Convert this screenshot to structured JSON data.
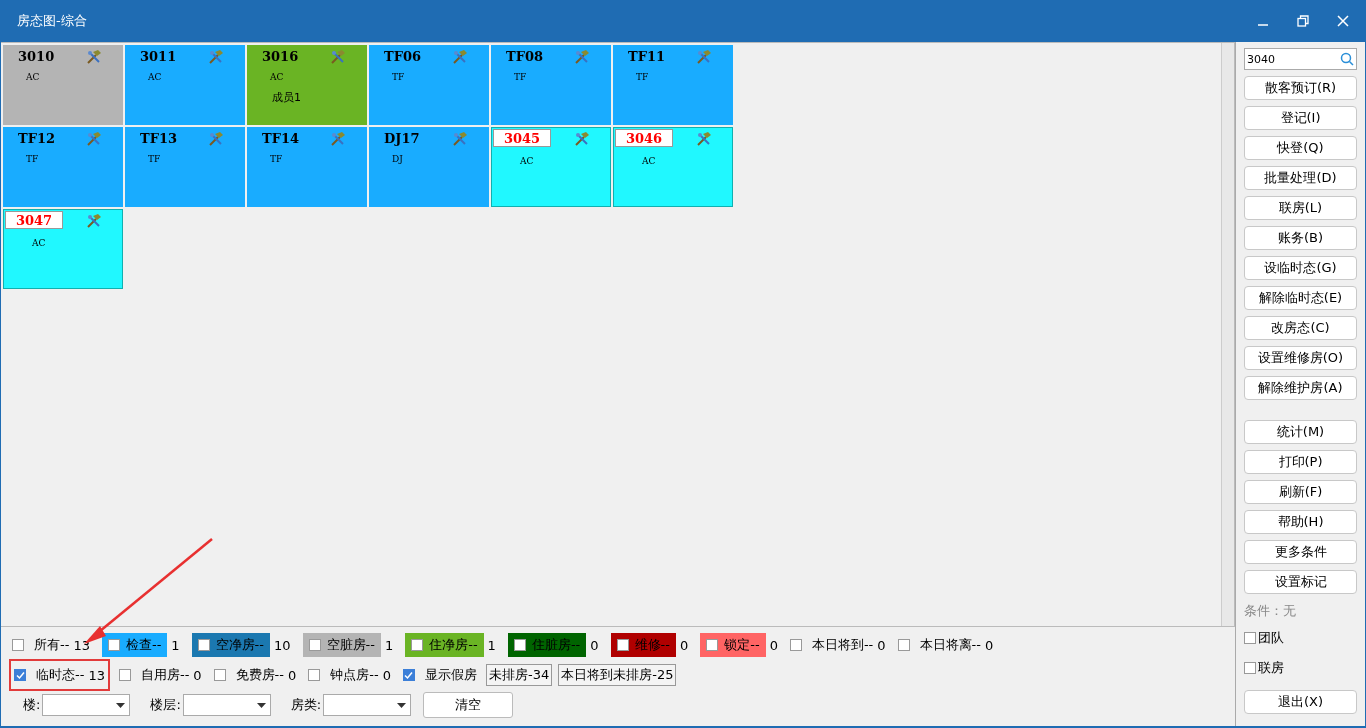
{
  "window": {
    "title": "房态图-综合"
  },
  "rooms": [
    {
      "number": "3010",
      "type": "AC",
      "color": "#b4b4b4",
      "temporary": false
    },
    {
      "number": "3011",
      "type": "AC",
      "color": "#19acff",
      "temporary": false
    },
    {
      "number": "3016",
      "type": "AC",
      "member": "成员1",
      "color": "#6ab424",
      "temporary": false
    },
    {
      "number": "TF06",
      "type": "TF",
      "color": "#19acff",
      "temporary": false
    },
    {
      "number": "TF08",
      "type": "TF",
      "color": "#19acff",
      "temporary": false
    },
    {
      "number": "TF11",
      "type": "TF",
      "color": "#19acff",
      "temporary": false
    },
    {
      "number": "TF12",
      "type": "TF",
      "color": "#19acff",
      "temporary": false
    },
    {
      "number": "TF13",
      "type": "TF",
      "color": "#19acff",
      "temporary": false
    },
    {
      "number": "TF14",
      "type": "TF",
      "color": "#19acff",
      "temporary": false
    },
    {
      "number": "DJ17",
      "type": "DJ",
      "color": "#19acff",
      "temporary": false
    },
    {
      "number": "3045",
      "type": "AC",
      "color": "#20f8ff",
      "temporary": true
    },
    {
      "number": "3046",
      "type": "AC",
      "color": "#20f8ff",
      "temporary": true
    },
    {
      "number": "3047",
      "type": "AC",
      "color": "#20f8ff",
      "temporary": true
    }
  ],
  "legend_rows": [
    [
      {
        "kind": "filter",
        "label": "所有--",
        "count": "13",
        "checked": false
      },
      {
        "kind": "filter",
        "label": "检查--",
        "count": "1",
        "color": "#19acff",
        "checked": false
      },
      {
        "kind": "filter",
        "label": "空净房--",
        "count": "10",
        "color": "#1b78b0",
        "checked": false
      },
      {
        "kind": "filter",
        "label": "空脏房--",
        "count": "1",
        "color": "#b4b4b4",
        "checked": false
      },
      {
        "kind": "filter",
        "label": "住净房--",
        "count": "1",
        "color": "#6ab424",
        "checked": false
      },
      {
        "kind": "filter",
        "label": "住脏房--",
        "count": "0",
        "color": "#006400",
        "checked": false
      },
      {
        "kind": "filter",
        "label": "维修--",
        "count": "0",
        "color": "#b00000",
        "checked": false
      },
      {
        "kind": "filter",
        "label": "锁定--",
        "count": "0",
        "color": "#ff6464",
        "checked": false
      },
      {
        "kind": "filter",
        "label": "本日将到--",
        "count": "0",
        "checked": false
      },
      {
        "kind": "filter",
        "label": "本日将离--",
        "count": "0",
        "checked": false
      }
    ],
    [
      {
        "kind": "filter",
        "label": "临时态--",
        "count": "13",
        "checked": true,
        "highlighted": true
      },
      {
        "kind": "filter",
        "label": "自用房--",
        "count": "0",
        "checked": false
      },
      {
        "kind": "filter",
        "label": "免费房--",
        "count": "0",
        "checked": false
      },
      {
        "kind": "filter",
        "label": "钟点房--",
        "count": "0",
        "checked": false
      },
      {
        "kind": "filter",
        "label": "显示假房",
        "checked": true
      },
      {
        "kind": "tally",
        "label": "未排房-34"
      },
      {
        "kind": "tally",
        "label": "本日将到未排房-25"
      }
    ]
  ],
  "selectors": [
    {
      "label": "楼:"
    },
    {
      "label": "楼层:"
    },
    {
      "label": "房类:"
    }
  ],
  "clear_button": "清空",
  "sidebar": {
    "search": {
      "value": "3040"
    },
    "buttons_top": [
      "散客预订(R)",
      "登记(I)",
      "快登(Q)",
      "批量处理(D)",
      "联房(L)",
      "账务(B)",
      "设临时态(G)",
      "解除临时态(E)",
      "改房态(C)",
      "设置维修房(O)",
      "解除维护房(A)"
    ],
    "buttons_bottom": [
      "统计(M)",
      "打印(P)",
      "刷新(F)",
      "帮助(H)",
      "更多条件",
      "设置标记"
    ],
    "condition": "条件：无",
    "checkboxes": [
      {
        "label": "团队",
        "checked": false
      },
      {
        "label": "联房",
        "checked": false
      }
    ],
    "exit_button": "退出(X)"
  }
}
